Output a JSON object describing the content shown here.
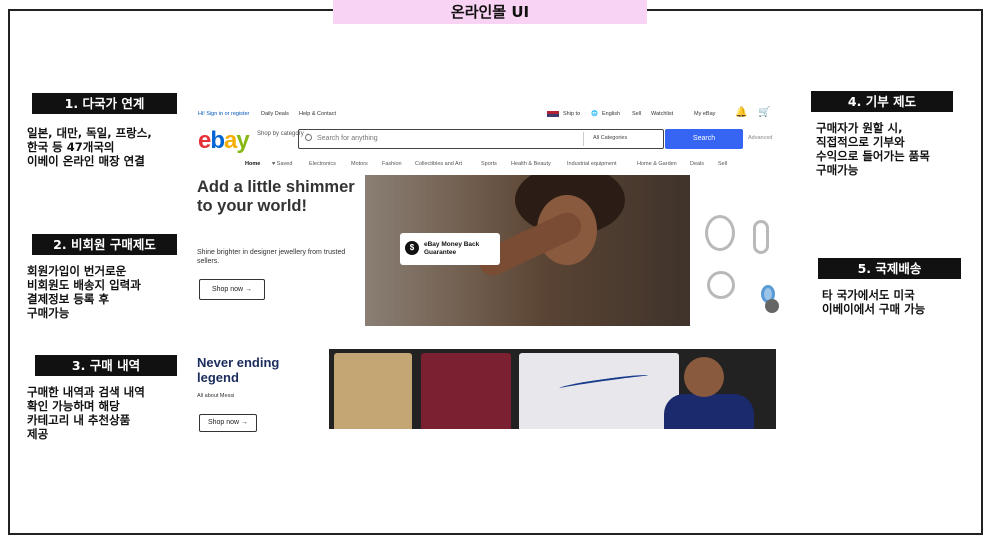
{
  "page_title": "온라인몰 UI",
  "sections": [
    {
      "label": "1. 다국가 연계",
      "desc": "일본, 대만, 독일, 프랑스,\n한국 등 47개국의\n이베이 온라인 매장 연결"
    },
    {
      "label": "2. 비회원 구매제도",
      "desc": "회원가입이 번거로운\n비회원도 배송지 입력과\n결제정보 등록 후\n구매가능"
    },
    {
      "label": "3. 구매 내역",
      "desc": "구매한 내역과 검색 내역\n확인 가능하며 해당\n카테고리 내 추천상품\n제공"
    },
    {
      "label": "4. 기부 제도",
      "desc": "구매자가 원할 시,\n직접적으로 기부와\n수익으로 들어가는 품목\n구매가능"
    },
    {
      "label": "5. 국제배송",
      "desc": "타 국가에서도 미국\n이베이에서 구매 가능"
    }
  ],
  "ebay": {
    "topbar": {
      "greeting": "Hi! Sign in or register",
      "daily_deals": "Daily Deals",
      "help": "Help & Contact",
      "ship_to": "Ship to",
      "language": "English",
      "sell": "Sell",
      "watchlist": "Watchlist",
      "my_ebay": "My eBay"
    },
    "logo": "ebay",
    "shop_by": "Shop by category",
    "search_placeholder": "Search for anything",
    "category": "All Categories",
    "search_button": "Search",
    "advanced": "Advanced",
    "nav": [
      "Home",
      "♥ Saved",
      "Electronics",
      "Motors",
      "Fashion",
      "Collectibles and Art",
      "Sports",
      "Health & Beauty",
      "Industrial equipment",
      "Home & Garden",
      "Deals",
      "Sell"
    ],
    "hero1": {
      "title": "Add a little shimmer to your world!",
      "subtitle": "Shine brighter in designer jewellery from trusted sellers.",
      "button": "Shop now →",
      "badge": "eBay Money Back Guarantee"
    },
    "hero2": {
      "title": "Never ending legend",
      "subtitle": "All about Messi",
      "button": "Shop now →"
    }
  }
}
